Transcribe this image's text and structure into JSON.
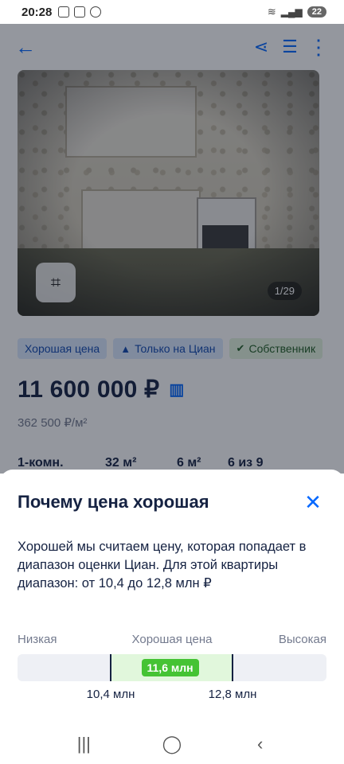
{
  "status_bar": {
    "time": "20:28",
    "battery": "22"
  },
  "app_bar": {
    "back_icon": "arrow-left-icon",
    "share_icon": "share-icon",
    "list_icon": "playlist-add-icon",
    "menu_icon": "more-vert-icon"
  },
  "listing": {
    "photo_counter": "1/29",
    "tags": [
      {
        "label": "Хорошая цена"
      },
      {
        "label": "Только на Циан"
      },
      {
        "label": "Собственник"
      }
    ],
    "price": "11 600 000 ₽",
    "price_per_sqm": "362 500 ₽/м²",
    "params": [
      "1-комн.",
      "32 м²",
      "6 м²",
      "6 из 9"
    ]
  },
  "sheet": {
    "title": "Почему цена хорошая",
    "description": "Хорошей мы считаем цену, которая попадает в диапазон оценки Циан. Для этой квартиры диапазон: от 10,4 до 12,8 млн ₽",
    "scale": {
      "low_label": "Низкая",
      "mid_label": "Хорошая цена",
      "high_label": "Высокая",
      "range_min": 10.4,
      "range_max": 12.8,
      "value": 11.6,
      "value_label": "11,6 млн",
      "min_label": "10,4 млн",
      "max_label": "12,8 млн"
    }
  },
  "colors": {
    "accent": "#0468ff",
    "good": "#45c334",
    "range_fill": "#e1f7dc"
  }
}
